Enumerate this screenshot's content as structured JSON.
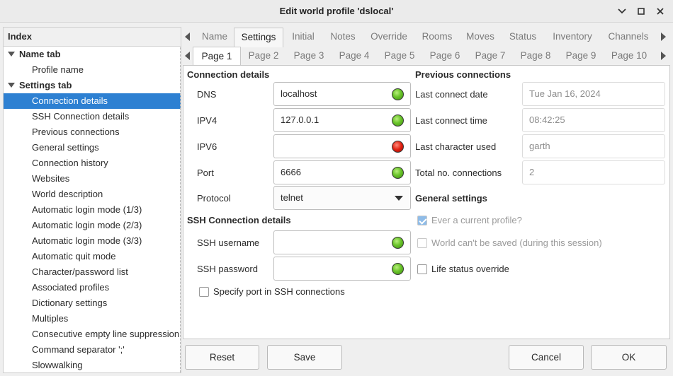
{
  "window": {
    "title": "Edit world profile 'dslocal'"
  },
  "index": {
    "header": "Index",
    "items": [
      {
        "label": "Name tab"
      },
      {
        "label": "Profile name"
      },
      {
        "label": "Settings tab"
      },
      {
        "label": "Connection details"
      },
      {
        "label": "SSH Connection details"
      },
      {
        "label": "Previous connections"
      },
      {
        "label": "General settings"
      },
      {
        "label": "Connection history"
      },
      {
        "label": "Websites"
      },
      {
        "label": "World description"
      },
      {
        "label": "Automatic login mode (1/3)"
      },
      {
        "label": "Automatic login mode (2/3)"
      },
      {
        "label": "Automatic login mode (3/3)"
      },
      {
        "label": "Automatic quit mode"
      },
      {
        "label": "Character/password list"
      },
      {
        "label": "Associated profiles"
      },
      {
        "label": "Dictionary settings"
      },
      {
        "label": "Multiples"
      },
      {
        "label": "Consecutive empty line suppression"
      },
      {
        "label": "Command separator ';'"
      },
      {
        "label": "Slowwalking"
      }
    ]
  },
  "tabs": [
    "Name",
    "Settings",
    "Initial",
    "Notes",
    "Override",
    "Rooms",
    "Moves",
    "Status",
    "Inventory",
    "Channels"
  ],
  "subtabs": [
    "Page 1",
    "Page 2",
    "Page 3",
    "Page 4",
    "Page 5",
    "Page 6",
    "Page 7",
    "Page 8",
    "Page 9",
    "Page 10"
  ],
  "connection": {
    "title": "Connection details",
    "dns_label": "DNS",
    "dns_value": "localhost",
    "ipv4_label": "IPV4",
    "ipv4_value": "127.0.0.1",
    "ipv6_label": "IPV6",
    "ipv6_value": "",
    "port_label": "Port",
    "port_value": "6666",
    "protocol_label": "Protocol",
    "protocol_value": "telnet"
  },
  "ssh": {
    "title": "SSH Connection details",
    "username_label": "SSH username",
    "username_value": "",
    "password_label": "SSH password",
    "password_value": "",
    "specify_port_label": "Specify port in SSH connections"
  },
  "previous": {
    "title": "Previous connections",
    "date_label": "Last connect date",
    "date_value": "Tue Jan 16, 2024",
    "time_label": "Last connect time",
    "time_value": "08:42:25",
    "char_label": "Last character used",
    "char_value": "garth",
    "total_label": "Total no. connections",
    "total_value": "2"
  },
  "general": {
    "title": "General settings",
    "current_profile_label": "Ever a current profile?",
    "cant_save_label": "World can't be saved (during this session)",
    "life_status_label": "Life status override"
  },
  "buttons": {
    "reset": "Reset",
    "save": "Save",
    "cancel": "Cancel",
    "ok": "OK"
  },
  "colors": {
    "selection": "#2d80d2",
    "led_ok": "#6ac42a",
    "led_error": "#e02010"
  }
}
